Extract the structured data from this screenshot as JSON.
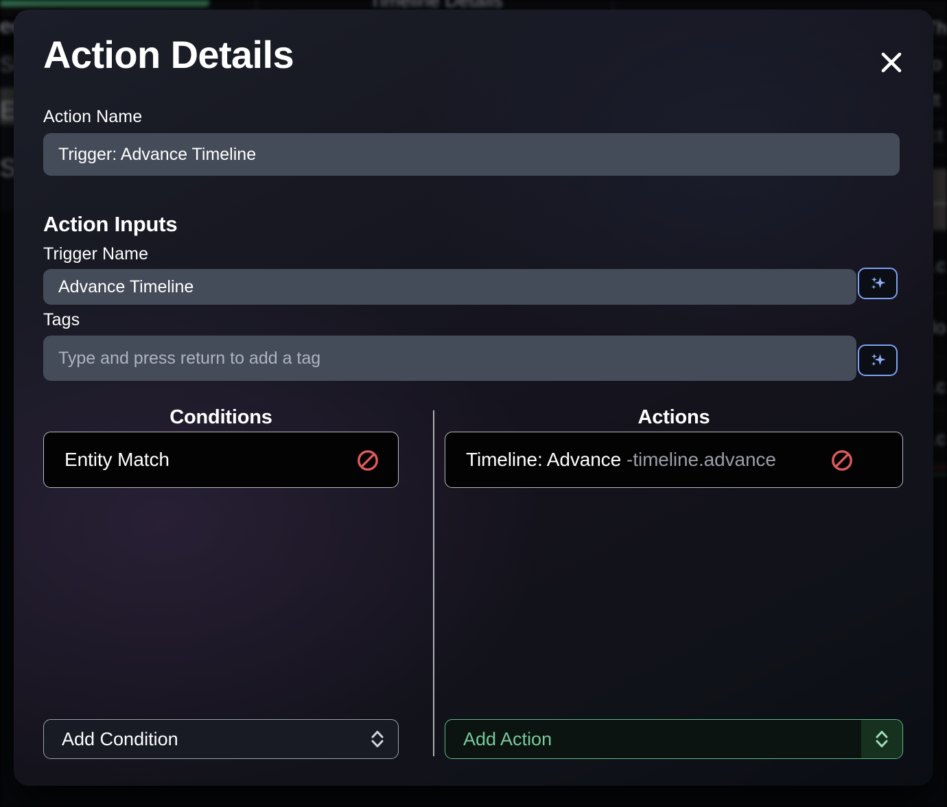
{
  "background": {
    "topbar_title": "Timeline Details",
    "left_fragments": [
      "ec",
      "Se",
      "E",
      "S"
    ],
    "right_fragments": [
      "Th",
      "lo",
      "itt",
      "act",
      "e  —",
      "n.c",
      ".do",
      "n.c",
      "n.c"
    ]
  },
  "modal": {
    "title": "Action Details",
    "close_icon": "close-icon",
    "fields": {
      "action_name_label": "Action Name",
      "action_name_value": "Trigger: Advance Timeline",
      "action_inputs_heading": "Action Inputs",
      "trigger_name_label": "Trigger Name",
      "trigger_name_value": "Advance Timeline",
      "tags_label": "Tags",
      "tags_value": "",
      "tags_placeholder": "Type and press return to add a tag"
    },
    "ai_buttons": {
      "trigger_name_icon": "sparkles-icon",
      "tags_icon": "sparkles-icon"
    },
    "conditions_panel": {
      "title": "Conditions",
      "items": [
        {
          "label": "Entity Match",
          "sub": "",
          "remove_icon": "prohibited-icon"
        }
      ],
      "add_select": {
        "label": "Add Condition",
        "stepper_icon": "chevron-up-down-icon"
      }
    },
    "actions_panel": {
      "title": "Actions",
      "items": [
        {
          "label": "Timeline: Advance",
          "separator": " - ",
          "sub": "timeline.advance",
          "remove_icon": "prohibited-icon"
        }
      ],
      "add_select": {
        "label": "Add Action",
        "stepper_icon": "chevron-up-down-icon"
      }
    }
  },
  "colors": {
    "accent_blue": "#7ea2f2",
    "accent_green": "#5fbf88",
    "danger_red": "#e05a5a",
    "input_bg": "#454c59",
    "panel_border": "#b9bcc4"
  }
}
